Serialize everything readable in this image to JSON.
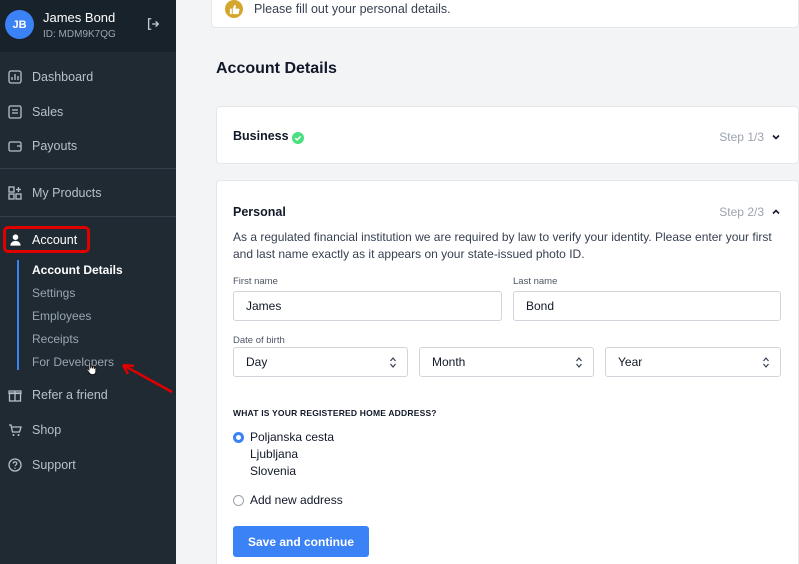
{
  "profile": {
    "initials": "JB",
    "name": "James Bond",
    "id_text": "ID: MDM9K7QG"
  },
  "sidebar": {
    "items": [
      {
        "label": "Dashboard",
        "icon": "dashboard-icon"
      },
      {
        "label": "Sales",
        "icon": "sales-icon"
      },
      {
        "label": "Payouts",
        "icon": "wallet-icon"
      },
      {
        "label": "My Products",
        "icon": "products-icon"
      },
      {
        "label": "Account",
        "icon": "user-icon"
      },
      {
        "label": "Refer a friend",
        "icon": "gift-icon"
      },
      {
        "label": "Shop",
        "icon": "cart-icon"
      },
      {
        "label": "Support",
        "icon": "help-icon"
      }
    ],
    "account_sub": [
      {
        "label": "Account Details"
      },
      {
        "label": "Settings"
      },
      {
        "label": "Employees"
      },
      {
        "label": "Receipts"
      },
      {
        "label": "For Developers"
      }
    ]
  },
  "notice": {
    "text": "Please fill out your personal details.",
    "icon": "thumbs-up-icon"
  },
  "page": {
    "title": "Account Details"
  },
  "business": {
    "title": "Business",
    "step": "Step 1/3",
    "completed": true
  },
  "personal": {
    "title": "Personal",
    "step": "Step 2/3",
    "description": "As a regulated financial institution we are required by law to verify your identity. Please enter your first and last name exactly as it appears on your state-issued photo ID.",
    "first_name_label": "First name",
    "first_name_value": "James",
    "last_name_label": "Last name",
    "last_name_value": "Bond",
    "dob_label": "Date of birth",
    "dob_day": "Day",
    "dob_month": "Month",
    "dob_year": "Year",
    "address_heading": "WHAT IS YOUR REGISTERED HOME ADDRESS?",
    "address_line1": "Poljanska cesta",
    "address_line2": "Ljubljana",
    "address_line3": "Slovenia",
    "add_new_address": "Add new address",
    "submit_label": "Save and continue"
  },
  "colors": {
    "sidebar_bg": "#1f2a33",
    "accent": "#3b82f6",
    "highlight_box": "#e00000",
    "success": "#4ade80"
  }
}
